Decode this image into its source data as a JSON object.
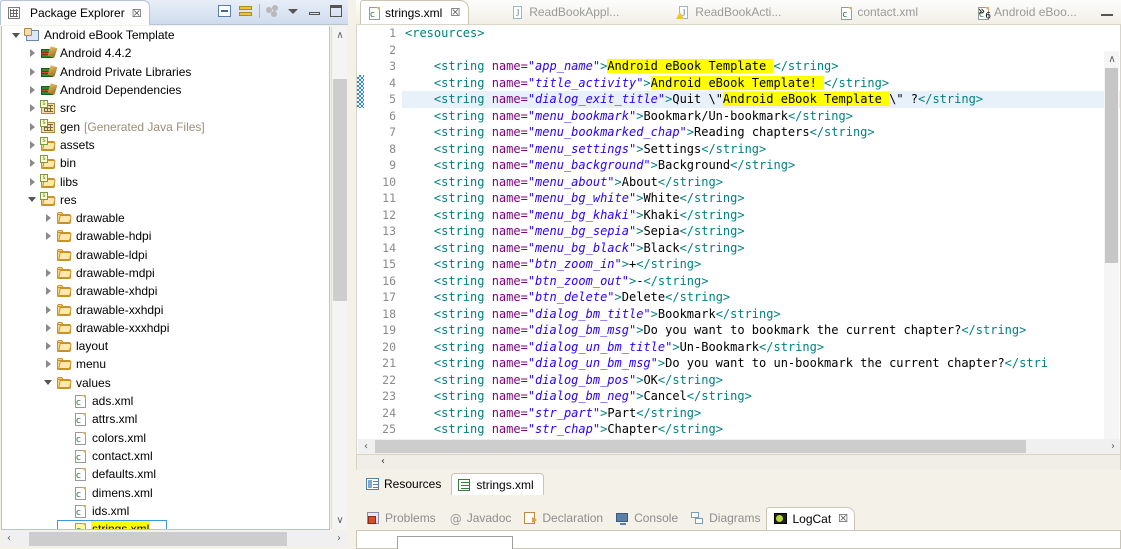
{
  "explorer": {
    "tab_label": "Package Explorer",
    "close_glyph": "☒",
    "toolbar_icons": [
      "collapse-all-icon",
      "link-with-editor-icon",
      "view-menu-icon",
      "minimize-icon",
      "maximize-icon"
    ],
    "tree": [
      {
        "label": "Android eBook Template",
        "sub": "",
        "depth": 0,
        "arrow": "open",
        "icon": "android-project-icon"
      },
      {
        "label": "Android 4.4.2",
        "sub": "",
        "depth": 1,
        "arrow": "closed",
        "icon": "library-icon"
      },
      {
        "label": "Android Private Libraries",
        "sub": "",
        "depth": 1,
        "arrow": "closed",
        "icon": "library-icon"
      },
      {
        "label": "Android Dependencies",
        "sub": "",
        "depth": 1,
        "arrow": "closed",
        "icon": "library-icon"
      },
      {
        "label": "src",
        "sub": "",
        "depth": 1,
        "arrow": "closed",
        "icon": "source-folder-icon"
      },
      {
        "label": "gen",
        "sub": "[Generated Java Files]",
        "depth": 1,
        "arrow": "closed",
        "icon": "source-folder-icon"
      },
      {
        "label": "assets",
        "sub": "",
        "depth": 1,
        "arrow": "closed",
        "icon": "folder-icon"
      },
      {
        "label": "bin",
        "sub": "",
        "depth": 1,
        "arrow": "closed",
        "icon": "folder-icon"
      },
      {
        "label": "libs",
        "sub": "",
        "depth": 1,
        "arrow": "closed",
        "icon": "folder-icon"
      },
      {
        "label": "res",
        "sub": "",
        "depth": 1,
        "arrow": "open",
        "icon": "folder-icon"
      },
      {
        "label": "drawable",
        "sub": "",
        "depth": 2,
        "arrow": "closed",
        "icon": "plain-folder-icon"
      },
      {
        "label": "drawable-hdpi",
        "sub": "",
        "depth": 2,
        "arrow": "closed",
        "icon": "plain-folder-icon"
      },
      {
        "label": "drawable-ldpi",
        "sub": "",
        "depth": 2,
        "arrow": "none",
        "icon": "plain-folder-icon"
      },
      {
        "label": "drawable-mdpi",
        "sub": "",
        "depth": 2,
        "arrow": "closed",
        "icon": "plain-folder-icon"
      },
      {
        "label": "drawable-xhdpi",
        "sub": "",
        "depth": 2,
        "arrow": "closed",
        "icon": "plain-folder-icon"
      },
      {
        "label": "drawable-xxhdpi",
        "sub": "",
        "depth": 2,
        "arrow": "closed",
        "icon": "plain-folder-icon"
      },
      {
        "label": "drawable-xxxhdpi",
        "sub": "",
        "depth": 2,
        "arrow": "closed",
        "icon": "plain-folder-icon"
      },
      {
        "label": "layout",
        "sub": "",
        "depth": 2,
        "arrow": "closed",
        "icon": "plain-folder-icon"
      },
      {
        "label": "menu",
        "sub": "",
        "depth": 2,
        "arrow": "closed",
        "icon": "plain-folder-icon"
      },
      {
        "label": "values",
        "sub": "",
        "depth": 2,
        "arrow": "open",
        "icon": "plain-folder-icon"
      },
      {
        "label": "ads.xml",
        "sub": "",
        "depth": 3,
        "arrow": "none",
        "icon": "xml-file-icon"
      },
      {
        "label": "attrs.xml",
        "sub": "",
        "depth": 3,
        "arrow": "none",
        "icon": "xml-file-icon"
      },
      {
        "label": "colors.xml",
        "sub": "",
        "depth": 3,
        "arrow": "none",
        "icon": "xml-file-icon"
      },
      {
        "label": "contact.xml",
        "sub": "",
        "depth": 3,
        "arrow": "none",
        "icon": "xml-file-icon"
      },
      {
        "label": "defaults.xml",
        "sub": "",
        "depth": 3,
        "arrow": "none",
        "icon": "xml-file-icon"
      },
      {
        "label": "dimens.xml",
        "sub": "",
        "depth": 3,
        "arrow": "none",
        "icon": "xml-file-icon"
      },
      {
        "label": "ids.xml",
        "sub": "",
        "depth": 3,
        "arrow": "none",
        "icon": "xml-file-icon"
      },
      {
        "label": "strings.xml",
        "sub": "",
        "depth": 3,
        "arrow": "none",
        "icon": "xml-file-icon",
        "selected": true
      }
    ]
  },
  "editor": {
    "tabs": [
      {
        "label": "strings.xml",
        "icon": "xml-file-icon",
        "active": true,
        "close": "☒"
      },
      {
        "label": "ReadBookAppl...",
        "icon": "java-file-icon",
        "active": false
      },
      {
        "label": "ReadBookActi...",
        "icon": "java-file-warning-icon",
        "active": false
      },
      {
        "label": "contact.xml",
        "icon": "xml-file-icon",
        "active": false
      },
      {
        "label": "Android eBoo...",
        "icon": "xml-file-icon",
        "active": false
      }
    ],
    "overflow_glyph": "»",
    "overflow_count": "6",
    "minimize_label": "minimize-icon",
    "current_line": 5,
    "changed_lines": [
      4,
      5
    ],
    "form_tabs": [
      {
        "label": "Resources",
        "icon": "resources-form-icon",
        "active": false
      },
      {
        "label": "strings.xml",
        "icon": "source-editor-icon",
        "active": true
      }
    ],
    "collapse_glyph": "‹",
    "lines": [
      {
        "n": 1,
        "segments": [
          {
            "t": "<resources>",
            "c": "tag"
          }
        ]
      },
      {
        "n": 2,
        "segments": []
      },
      {
        "n": 3,
        "segments": [
          {
            "t": "    <string ",
            "c": "tag"
          },
          {
            "t": "name=",
            "c": "attr"
          },
          {
            "t": "\"app_name\"",
            "c": "val"
          },
          {
            "t": ">",
            "c": "tag"
          },
          {
            "t": "Android eBook Template ",
            "c": "txt hl"
          },
          {
            "t": "</string>",
            "c": "tag"
          }
        ]
      },
      {
        "n": 4,
        "segments": [
          {
            "t": "    <string ",
            "c": "tag"
          },
          {
            "t": "name=",
            "c": "attr"
          },
          {
            "t": "\"title_activity\"",
            "c": "val"
          },
          {
            "t": ">",
            "c": "tag"
          },
          {
            "t": "Android eBook Template! ",
            "c": "txt hl"
          },
          {
            "t": "</string>",
            "c": "tag"
          }
        ]
      },
      {
        "n": 5,
        "segments": [
          {
            "t": "    <string ",
            "c": "tag"
          },
          {
            "t": "name=",
            "c": "attr"
          },
          {
            "t": "\"dialog_exit_title\"",
            "c": "val"
          },
          {
            "t": ">",
            "c": "tag"
          },
          {
            "t": "Quit \\\"",
            "c": "txt"
          },
          {
            "t": "Android eBook Template ",
            "c": "txt hl"
          },
          {
            "t": "\\\" ?",
            "c": "txt"
          },
          {
            "t": "</string>",
            "c": "tag"
          }
        ]
      },
      {
        "n": 6,
        "segments": [
          {
            "t": "    <string ",
            "c": "tag"
          },
          {
            "t": "name=",
            "c": "attr"
          },
          {
            "t": "\"menu_bookmark\"",
            "c": "val"
          },
          {
            "t": ">",
            "c": "tag"
          },
          {
            "t": "Bookmark/Un-bookmark",
            "c": "txt"
          },
          {
            "t": "</string>",
            "c": "tag"
          }
        ]
      },
      {
        "n": 7,
        "segments": [
          {
            "t": "    <string ",
            "c": "tag"
          },
          {
            "t": "name=",
            "c": "attr"
          },
          {
            "t": "\"menu_bookmarked_chap\"",
            "c": "val"
          },
          {
            "t": ">",
            "c": "tag"
          },
          {
            "t": "Reading chapters",
            "c": "txt"
          },
          {
            "t": "</string>",
            "c": "tag"
          }
        ]
      },
      {
        "n": 8,
        "segments": [
          {
            "t": "    <string ",
            "c": "tag"
          },
          {
            "t": "name=",
            "c": "attr"
          },
          {
            "t": "\"menu_settings\"",
            "c": "val"
          },
          {
            "t": ">",
            "c": "tag"
          },
          {
            "t": "Settings",
            "c": "txt"
          },
          {
            "t": "</string>",
            "c": "tag"
          }
        ]
      },
      {
        "n": 9,
        "segments": [
          {
            "t": "    <string ",
            "c": "tag"
          },
          {
            "t": "name=",
            "c": "attr"
          },
          {
            "t": "\"menu_background\"",
            "c": "val"
          },
          {
            "t": ">",
            "c": "tag"
          },
          {
            "t": "Background",
            "c": "txt"
          },
          {
            "t": "</string>",
            "c": "tag"
          }
        ]
      },
      {
        "n": 10,
        "segments": [
          {
            "t": "    <string ",
            "c": "tag"
          },
          {
            "t": "name=",
            "c": "attr"
          },
          {
            "t": "\"menu_about\"",
            "c": "val"
          },
          {
            "t": ">",
            "c": "tag"
          },
          {
            "t": "About",
            "c": "txt"
          },
          {
            "t": "</string>",
            "c": "tag"
          }
        ]
      },
      {
        "n": 11,
        "segments": [
          {
            "t": "    <string ",
            "c": "tag"
          },
          {
            "t": "name=",
            "c": "attr"
          },
          {
            "t": "\"menu_bg_white\"",
            "c": "val"
          },
          {
            "t": ">",
            "c": "tag"
          },
          {
            "t": "White",
            "c": "txt"
          },
          {
            "t": "</string>",
            "c": "tag"
          }
        ]
      },
      {
        "n": 12,
        "segments": [
          {
            "t": "    <string ",
            "c": "tag"
          },
          {
            "t": "name=",
            "c": "attr"
          },
          {
            "t": "\"menu_bg_khaki\"",
            "c": "val"
          },
          {
            "t": ">",
            "c": "tag"
          },
          {
            "t": "Khaki",
            "c": "txt"
          },
          {
            "t": "</string>",
            "c": "tag"
          }
        ]
      },
      {
        "n": 13,
        "segments": [
          {
            "t": "    <string ",
            "c": "tag"
          },
          {
            "t": "name=",
            "c": "attr"
          },
          {
            "t": "\"menu_bg_sepia\"",
            "c": "val"
          },
          {
            "t": ">",
            "c": "tag"
          },
          {
            "t": "Sepia",
            "c": "txt"
          },
          {
            "t": "</string>",
            "c": "tag"
          }
        ]
      },
      {
        "n": 14,
        "segments": [
          {
            "t": "    <string ",
            "c": "tag"
          },
          {
            "t": "name=",
            "c": "attr"
          },
          {
            "t": "\"menu_bg_black\"",
            "c": "val"
          },
          {
            "t": ">",
            "c": "tag"
          },
          {
            "t": "Black",
            "c": "txt"
          },
          {
            "t": "</string>",
            "c": "tag"
          }
        ]
      },
      {
        "n": 15,
        "segments": [
          {
            "t": "    <string ",
            "c": "tag"
          },
          {
            "t": "name=",
            "c": "attr"
          },
          {
            "t": "\"btn_zoom_in\"",
            "c": "val"
          },
          {
            "t": ">",
            "c": "tag"
          },
          {
            "t": "+",
            "c": "txt"
          },
          {
            "t": "</string>",
            "c": "tag"
          }
        ]
      },
      {
        "n": 16,
        "segments": [
          {
            "t": "    <string ",
            "c": "tag"
          },
          {
            "t": "name=",
            "c": "attr"
          },
          {
            "t": "\"btn_zoom_out\"",
            "c": "val"
          },
          {
            "t": ">",
            "c": "tag"
          },
          {
            "t": "-",
            "c": "txt"
          },
          {
            "t": "</string>",
            "c": "tag"
          }
        ]
      },
      {
        "n": 17,
        "segments": [
          {
            "t": "    <string ",
            "c": "tag"
          },
          {
            "t": "name=",
            "c": "attr"
          },
          {
            "t": "\"btn_delete\"",
            "c": "val"
          },
          {
            "t": ">",
            "c": "tag"
          },
          {
            "t": "Delete",
            "c": "txt"
          },
          {
            "t": "</string>",
            "c": "tag"
          }
        ]
      },
      {
        "n": 18,
        "segments": [
          {
            "t": "    <string ",
            "c": "tag"
          },
          {
            "t": "name=",
            "c": "attr"
          },
          {
            "t": "\"dialog_bm_title\"",
            "c": "val"
          },
          {
            "t": ">",
            "c": "tag"
          },
          {
            "t": "Bookmark",
            "c": "txt"
          },
          {
            "t": "</string>",
            "c": "tag"
          }
        ]
      },
      {
        "n": 19,
        "segments": [
          {
            "t": "    <string ",
            "c": "tag"
          },
          {
            "t": "name=",
            "c": "attr"
          },
          {
            "t": "\"dialog_bm_msg\"",
            "c": "val"
          },
          {
            "t": ">",
            "c": "tag"
          },
          {
            "t": "Do you want to bookmark the current chapter?",
            "c": "txt"
          },
          {
            "t": "</string>",
            "c": "tag"
          }
        ]
      },
      {
        "n": 20,
        "segments": [
          {
            "t": "    <string ",
            "c": "tag"
          },
          {
            "t": "name=",
            "c": "attr"
          },
          {
            "t": "\"dialog_un_bm_title\"",
            "c": "val"
          },
          {
            "t": ">",
            "c": "tag"
          },
          {
            "t": "Un-Bookmark",
            "c": "txt"
          },
          {
            "t": "</string>",
            "c": "tag"
          }
        ]
      },
      {
        "n": 21,
        "segments": [
          {
            "t": "    <string ",
            "c": "tag"
          },
          {
            "t": "name=",
            "c": "attr"
          },
          {
            "t": "\"dialog_un_bm_msg\"",
            "c": "val"
          },
          {
            "t": ">",
            "c": "tag"
          },
          {
            "t": "Do you want to un-bookmark the current chapter?",
            "c": "txt"
          },
          {
            "t": "</stri",
            "c": "tag"
          }
        ]
      },
      {
        "n": 22,
        "segments": [
          {
            "t": "    <string ",
            "c": "tag"
          },
          {
            "t": "name=",
            "c": "attr"
          },
          {
            "t": "\"dialog_bm_pos\"",
            "c": "val"
          },
          {
            "t": ">",
            "c": "tag"
          },
          {
            "t": "OK",
            "c": "txt"
          },
          {
            "t": "</string>",
            "c": "tag"
          }
        ]
      },
      {
        "n": 23,
        "segments": [
          {
            "t": "    <string ",
            "c": "tag"
          },
          {
            "t": "name=",
            "c": "attr"
          },
          {
            "t": "\"dialog_bm_neg\"",
            "c": "val"
          },
          {
            "t": ">",
            "c": "tag"
          },
          {
            "t": "Cancel",
            "c": "txt"
          },
          {
            "t": "</string>",
            "c": "tag"
          }
        ]
      },
      {
        "n": 24,
        "segments": [
          {
            "t": "    <string ",
            "c": "tag"
          },
          {
            "t": "name=",
            "c": "attr"
          },
          {
            "t": "\"str_part\"",
            "c": "val"
          },
          {
            "t": ">",
            "c": "tag"
          },
          {
            "t": "Part",
            "c": "txt"
          },
          {
            "t": "</string>",
            "c": "tag"
          }
        ]
      },
      {
        "n": 25,
        "segments": [
          {
            "t": "    <string ",
            "c": "tag"
          },
          {
            "t": "name=",
            "c": "attr"
          },
          {
            "t": "\"str_chap\"",
            "c": "val"
          },
          {
            "t": ">",
            "c": "tag"
          },
          {
            "t": "Chapter",
            "c": "txt"
          },
          {
            "t": "</string>",
            "c": "tag"
          }
        ]
      }
    ]
  },
  "bottom_view": {
    "tabs": [
      {
        "label": "Problems",
        "icon": "problems-icon",
        "active": false
      },
      {
        "label": "Javadoc",
        "icon": "javadoc-icon",
        "active": false
      },
      {
        "label": "Declaration",
        "icon": "declaration-icon",
        "active": false
      },
      {
        "label": "Console",
        "icon": "console-icon",
        "active": false
      },
      {
        "label": "Diagrams",
        "icon": "diagrams-icon",
        "active": false
      },
      {
        "label": "LogCat",
        "icon": "logcat-icon",
        "active": true,
        "close": "☒"
      }
    ]
  },
  "scroll": {
    "up_glyph": "∧",
    "down_glyph": "∨",
    "left_glyph": "‹",
    "right_glyph": "›"
  },
  "colors": {
    "highlight": "#ffff00",
    "current_line": "#e8f0fa",
    "tag": "#008080",
    "attr": "#7f007f",
    "value": "#2a00ff",
    "selection_border": "#3a9ad9",
    "change_marker": "#2e88d8",
    "chrome": "#f3f1e8"
  }
}
